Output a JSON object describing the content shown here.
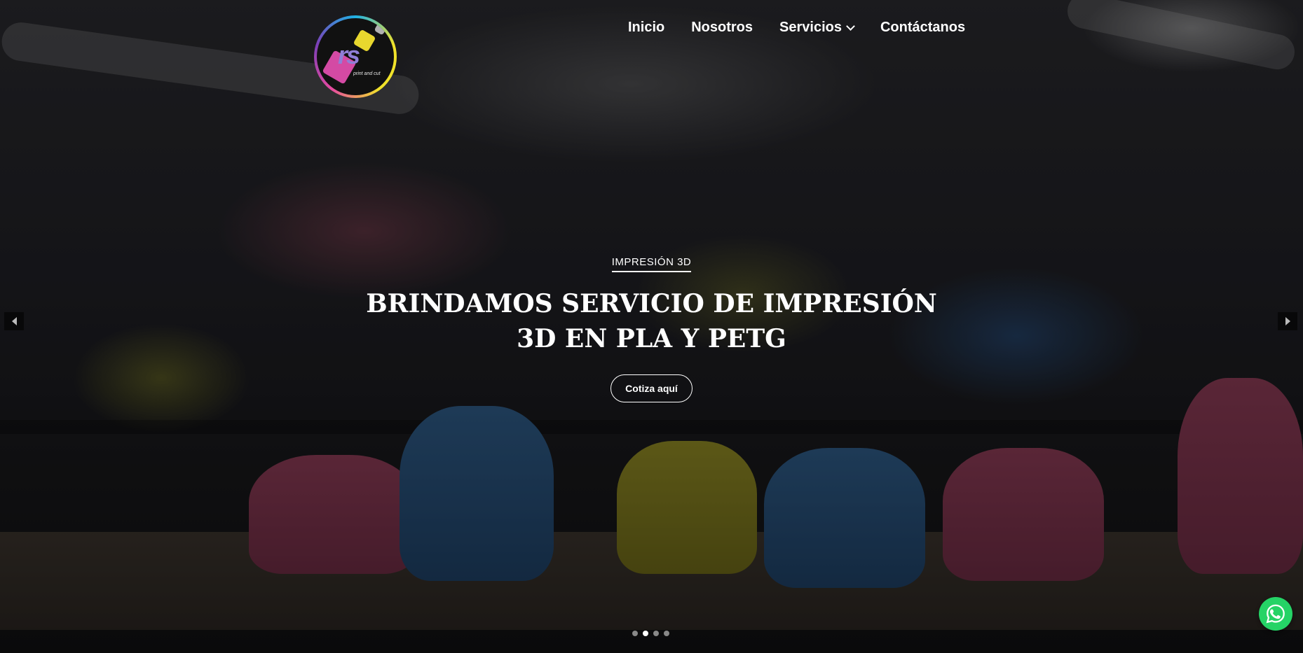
{
  "brand": {
    "logo_text": "rs",
    "logo_tagline": "print and cut"
  },
  "nav": {
    "items": [
      {
        "label": "Inicio"
      },
      {
        "label": "Nosotros"
      },
      {
        "label": "Servicios"
      },
      {
        "label": "Contáctanos"
      }
    ]
  },
  "hero": {
    "eyebrow": "IMPRESIÓN 3D",
    "headline": "BRINDAMOS SERVICIO DE IMPRESIÓN 3D EN PLA Y PETG",
    "cta_label": "Cotiza aquí",
    "slides_count": 4,
    "active_slide": 2
  },
  "colors": {
    "whatsapp": "#25d366",
    "text": "#ffffff"
  },
  "icons": {
    "prev": "chevron-left-icon",
    "next": "chevron-right-icon",
    "dropdown": "chevron-down-icon",
    "whatsapp": "whatsapp-icon"
  }
}
